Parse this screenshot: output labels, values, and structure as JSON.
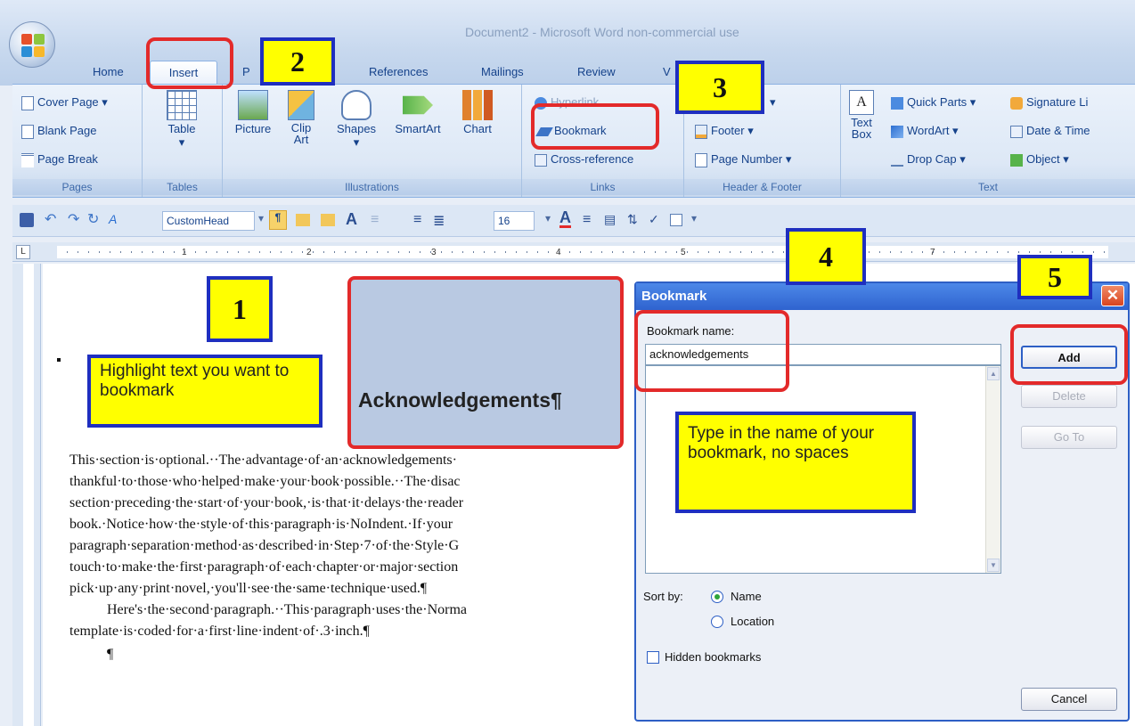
{
  "window": {
    "title": "Document2 - Microsoft Word non-commercial use"
  },
  "tabs": [
    {
      "label": "Home"
    },
    {
      "label": "Insert"
    },
    {
      "label": "P"
    },
    {
      "label": "References"
    },
    {
      "label": "Mailings"
    },
    {
      "label": "Review"
    },
    {
      "label": "V"
    }
  ],
  "ribbon": {
    "pages": {
      "label": "Pages",
      "items": [
        "Cover Page",
        "Blank Page",
        "Page Break"
      ]
    },
    "tables": {
      "label": "Tables",
      "item": "Table"
    },
    "illustrations": {
      "label": "Illustrations",
      "items": [
        "Picture",
        "Clip Art",
        "Shapes",
        "SmartArt",
        "Chart"
      ]
    },
    "links": {
      "label": "Links",
      "items": [
        "Hyperlink",
        "Bookmark",
        "Cross-reference"
      ]
    },
    "header_footer": {
      "label": "Header & Footer",
      "items": [
        "Footer",
        "Page Number"
      ]
    },
    "text": {
      "label": "Text",
      "items": [
        "Text Box",
        "Quick Parts",
        "WordArt",
        "Drop Cap",
        "Signature Li",
        "Date & Time",
        "Object"
      ]
    }
  },
  "quick_access": {
    "style": "CustomHead",
    "size": "16"
  },
  "ruler": {
    "numbers": [
      "1",
      "2",
      "3",
      "4",
      "5",
      "7"
    ]
  },
  "document": {
    "heading": "Acknowledgements¶",
    "paragraph_lines": [
      "This·section·is·optional.··The·advantage·of·an·acknowledgements·",
      "thankful·to·those·who·helped·make·your·book·possible.··The·disac",
      "section·preceding·the·start·of·your·book,·is·that·it·delays·the·reader",
      "book.·Notice·how·the·style·of·this·paragraph·is·NoIndent.·If·your",
      "paragraph·separation·method·as·described·in·Step·7·of·the·Style·G",
      "touch·to·make·the·first·paragraph·of·each·chapter·or·major·section",
      "pick·up·any·print·novel,·you'll·see·the·same·technique·used.¶",
      "Here's·the·second·paragraph.··This·paragraph·uses·the·Norma",
      "template·is·coded·for·a·first·line·indent·of·.3·inch.¶",
      "¶"
    ]
  },
  "callouts": {
    "step1": "1",
    "step2": "2",
    "step3": "3",
    "step4": "4",
    "step5": "5",
    "note_highlight": "Highlight text you want to bookmark",
    "note_type": "Type in the name of your bookmark, no spaces"
  },
  "dialog": {
    "title": "Bookmark",
    "close_label": "✕",
    "name_label": "Bookmark name:",
    "name_value": "acknowledgements",
    "buttons": {
      "add": "Add",
      "delete": "Delete",
      "goto": "Go To",
      "cancel": "Cancel"
    },
    "sort_label": "Sort by:",
    "sort_options": [
      "Name",
      "Location"
    ],
    "sort_selected": "Name",
    "hidden_label": "Hidden bookmarks"
  },
  "colors": {
    "highlight_red": "#e32a2a",
    "callout_yellow": "#ffff00",
    "callout_blue": "#1f2fbf",
    "title_blue": "#2f63cf"
  }
}
